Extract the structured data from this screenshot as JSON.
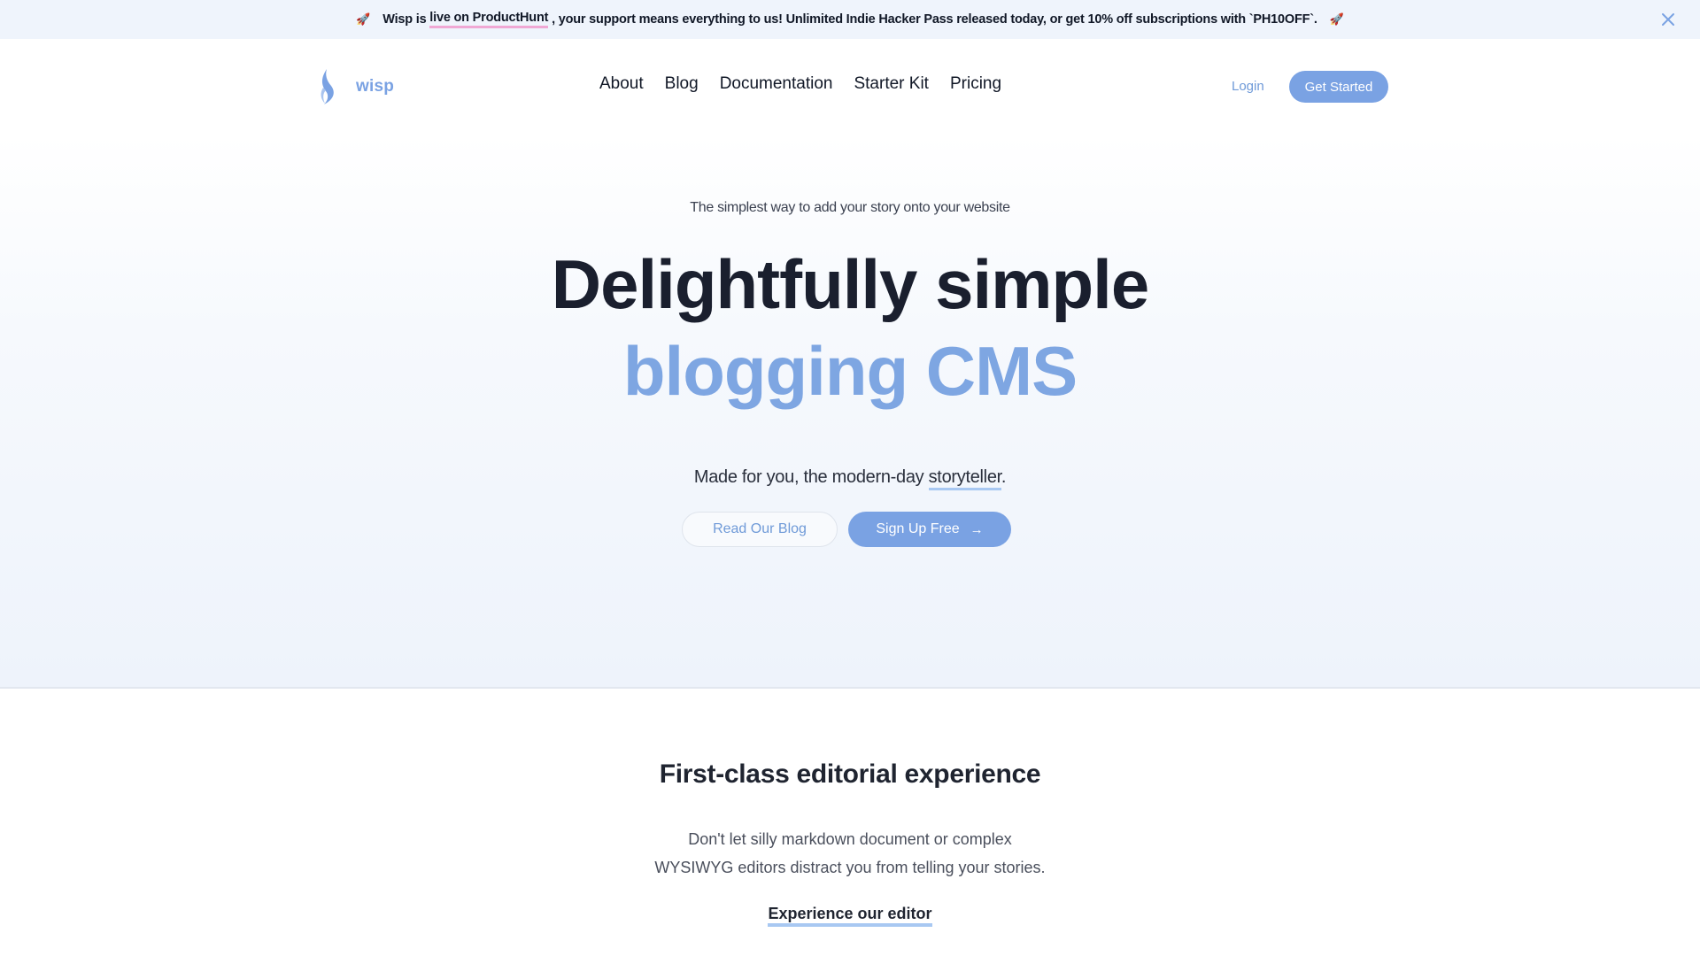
{
  "banner": {
    "prefix": "Wisp is ",
    "highlight_link": "live on ProductHunt",
    "suffix": " , your support means everything to us! Unlimited Indie Hacker Pass released today, or get 10% off subscriptions with `PH10OFF`.",
    "leading_icon": "rocket-icon",
    "trailing_icon": "rocket-icon",
    "rocket_glyph": "🚀",
    "close_icon": "close-icon",
    "highlight_color": "#f0a8d4"
  },
  "nav": {
    "logo_text": "wisp",
    "links": [
      {
        "label": "About"
      },
      {
        "label": "Blog"
      },
      {
        "label": "Documentation"
      },
      {
        "label": "Starter Kit"
      },
      {
        "label": "Pricing"
      }
    ],
    "login_label": "Login",
    "cta_label": "Get Started"
  },
  "hero": {
    "eyebrow": "The simplest way to add your story onto your website",
    "title_line1": "Delightfully simple",
    "title_line2": "blogging CMS",
    "tagline_prefix": "Made for you, the modern-day ",
    "tagline_highlight": "storyteller",
    "tagline_suffix": ".",
    "secondary_button": "Read Our Blog",
    "primary_button": "Sign Up Free",
    "primary_button_icon": "→"
  },
  "feature": {
    "title": "First-class editorial experience",
    "desc_line1": "Don't let silly markdown document or complex",
    "desc_line2": "WYSIWYG editors distract you from telling your stories.",
    "link_label": "Experience our editor"
  },
  "colors": {
    "accent": "#7aa2e3",
    "text_dark": "#1a1f2e",
    "banner_bg": "#eff4fc",
    "underline": "#a8c8f2"
  }
}
